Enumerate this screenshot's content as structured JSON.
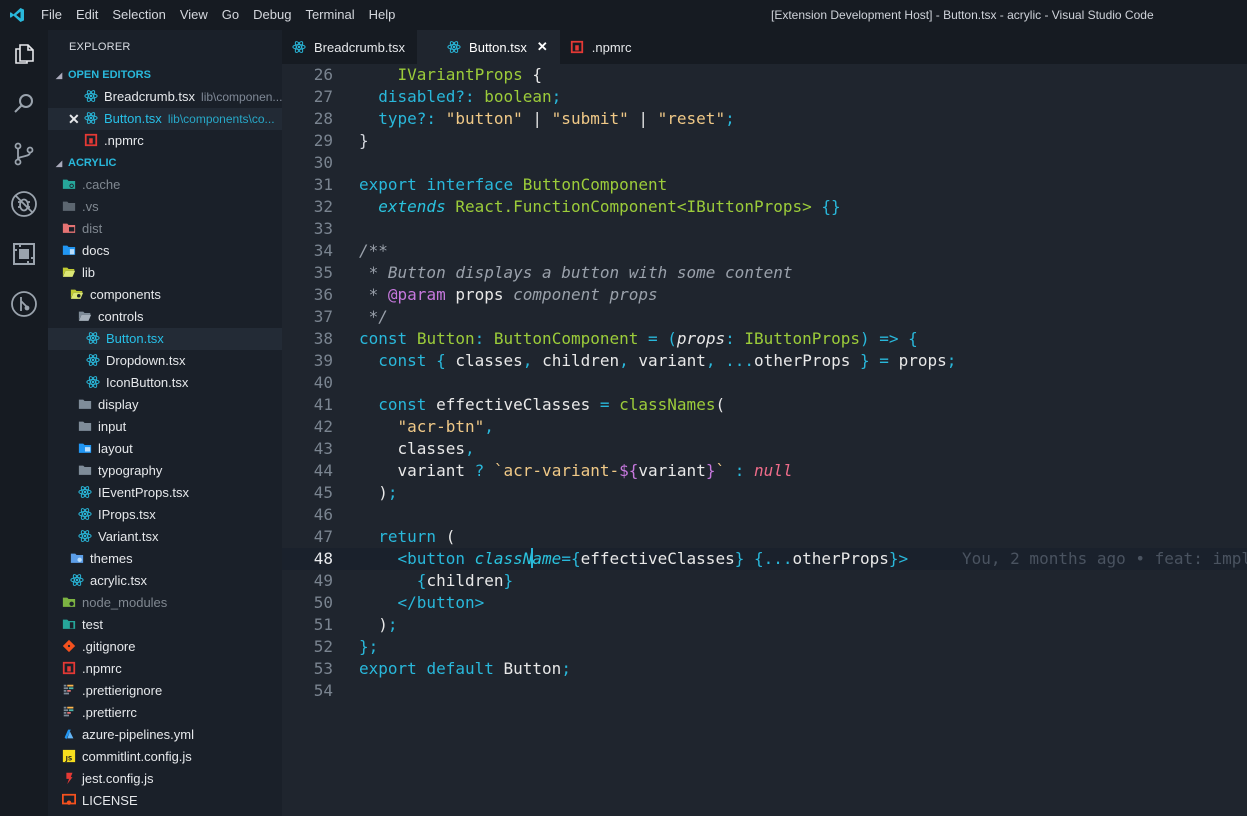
{
  "titlebar": {
    "menu": [
      "File",
      "Edit",
      "Selection",
      "View",
      "Go",
      "Debug",
      "Terminal",
      "Help"
    ],
    "window_title": "[Extension Development Host] - Button.tsx - acrylic - Visual Studio Code"
  },
  "activity_bar": [
    "explorer-icon",
    "search-icon",
    "source-control-icon",
    "debug-icon",
    "extensions-icon",
    "git-history-icon"
  ],
  "explorer": {
    "title": "EXPLORER",
    "open_editors_title": "OPEN EDITORS",
    "open_editors": [
      {
        "name": "Breadcrumb.tsx",
        "path": "lib\\componen..."
      },
      {
        "name": "Button.tsx",
        "path": "lib\\components\\co..."
      },
      {
        "name": ".npmrc",
        "path": ""
      }
    ],
    "project_title": "ACRYLIC",
    "tree": [
      {
        "label": ".cache"
      },
      {
        "label": ".vs"
      },
      {
        "label": "dist"
      },
      {
        "label": "docs"
      },
      {
        "label": "lib"
      },
      {
        "label": "components"
      },
      {
        "label": "controls"
      },
      {
        "label": "Button.tsx"
      },
      {
        "label": "Dropdown.tsx"
      },
      {
        "label": "IconButton.tsx"
      },
      {
        "label": "display"
      },
      {
        "label": "input"
      },
      {
        "label": "layout"
      },
      {
        "label": "typography"
      },
      {
        "label": "IEventProps.tsx"
      },
      {
        "label": "IProps.tsx"
      },
      {
        "label": "Variant.tsx"
      },
      {
        "label": "themes"
      },
      {
        "label": "acrylic.tsx"
      },
      {
        "label": "node_modules"
      },
      {
        "label": "test"
      },
      {
        "label": ".gitignore"
      },
      {
        "label": ".npmrc"
      },
      {
        "label": ".prettierignore"
      },
      {
        "label": ".prettierrc"
      },
      {
        "label": "azure-pipelines.yml"
      },
      {
        "label": "commitlint.config.js"
      },
      {
        "label": "jest.config.js"
      },
      {
        "label": "LICENSE"
      }
    ]
  },
  "tabs": [
    {
      "label": "Breadcrumb.tsx",
      "active": false
    },
    {
      "label": "Button.tsx",
      "active": true,
      "close": "✕"
    },
    {
      "label": ".npmrc",
      "active": false
    }
  ],
  "editor": {
    "current_line": 48,
    "blame": "You, 2 months ago • feat: impl",
    "lines": [
      {
        "n": "26",
        "tokens": [
          [
            "",
            "    "
          ],
          [
            "ty",
            "IVariantProps"
          ],
          [
            "p",
            " {"
          ]
        ]
      },
      {
        "n": "27",
        "tokens": [
          [
            "",
            "  "
          ],
          [
            "k",
            "disabled?:"
          ],
          [
            "",
            " "
          ],
          [
            "ty",
            "boolean"
          ],
          [
            "k",
            ";"
          ]
        ]
      },
      {
        "n": "28",
        "tokens": [
          [
            "",
            "  "
          ],
          [
            "k",
            "type?:"
          ],
          [
            "",
            " "
          ],
          [
            "s",
            "\"button\""
          ],
          [
            "p",
            " | "
          ],
          [
            "s",
            "\"submit\""
          ],
          [
            "p",
            " | "
          ],
          [
            "s",
            "\"reset\""
          ],
          [
            "k",
            ";"
          ]
        ]
      },
      {
        "n": "29",
        "tokens": [
          [
            "",
            "}"
          ]
        ]
      },
      {
        "n": "30",
        "tokens": []
      },
      {
        "n": "31",
        "tokens": [
          [
            "k",
            "export"
          ],
          [
            "",
            " "
          ],
          [
            "k",
            "interface"
          ],
          [
            "",
            " "
          ],
          [
            "ty",
            "ButtonComponent"
          ]
        ]
      },
      {
        "n": "32",
        "tokens": [
          [
            "",
            "  "
          ],
          [
            "i",
            "extends"
          ],
          [
            "",
            " "
          ],
          [
            "ty",
            "React.FunctionComponent<IButtonProps>"
          ],
          [
            "",
            " "
          ],
          [
            "k",
            "{}"
          ]
        ]
      },
      {
        "n": "33",
        "tokens": []
      },
      {
        "n": "34",
        "tokens": [
          [
            "c",
            "/**"
          ]
        ]
      },
      {
        "n": "35",
        "tokens": [
          [
            "c",
            " * Button displays a button with some content"
          ]
        ]
      },
      {
        "n": "36",
        "tokens": [
          [
            "c",
            " * "
          ],
          [
            "tm",
            "@param"
          ],
          [
            "",
            " "
          ],
          [
            "v",
            "props"
          ],
          [
            "c",
            " component props"
          ]
        ]
      },
      {
        "n": "37",
        "tokens": [
          [
            "c",
            " */"
          ]
        ]
      },
      {
        "n": "38",
        "tokens": [
          [
            "k",
            "const"
          ],
          [
            "",
            " "
          ],
          [
            "ty",
            "Button"
          ],
          [
            "k",
            ":"
          ],
          [
            "",
            " "
          ],
          [
            "ty",
            "ButtonComponent"
          ],
          [
            "k",
            " = ("
          ],
          [
            "pi",
            "props"
          ],
          [
            "k",
            ":"
          ],
          [
            "",
            " "
          ],
          [
            "ty",
            "IButtonProps"
          ],
          [
            "k",
            ") => {"
          ]
        ]
      },
      {
        "n": "39",
        "tokens": [
          [
            "",
            "  "
          ],
          [
            "k",
            "const"
          ],
          [
            "",
            " "
          ],
          [
            "k",
            "{"
          ],
          [
            "",
            " "
          ],
          [
            "v",
            "classes"
          ],
          [
            "k",
            ","
          ],
          [
            "",
            " "
          ],
          [
            "v",
            "children"
          ],
          [
            "k",
            ","
          ],
          [
            "",
            " "
          ],
          [
            "v",
            "variant"
          ],
          [
            "k",
            ","
          ],
          [
            "",
            " "
          ],
          [
            "k",
            "..."
          ],
          [
            "v",
            "otherProps"
          ],
          [
            "",
            " "
          ],
          [
            "k",
            "} ="
          ],
          [
            "",
            " "
          ],
          [
            "v",
            "props"
          ],
          [
            "k",
            ";"
          ]
        ]
      },
      {
        "n": "40",
        "tokens": []
      },
      {
        "n": "41",
        "tokens": [
          [
            "",
            "  "
          ],
          [
            "k",
            "const"
          ],
          [
            "",
            " "
          ],
          [
            "v",
            "effectiveClasses"
          ],
          [
            "",
            " "
          ],
          [
            "k",
            "="
          ],
          [
            "",
            " "
          ],
          [
            "ty",
            "classNames"
          ],
          [
            "p",
            "("
          ]
        ]
      },
      {
        "n": "42",
        "tokens": [
          [
            "",
            "    "
          ],
          [
            "s",
            "\"acr-btn\""
          ],
          [
            "k",
            ","
          ]
        ]
      },
      {
        "n": "43",
        "tokens": [
          [
            "",
            "    "
          ],
          [
            "v",
            "classes"
          ],
          [
            "k",
            ","
          ]
        ]
      },
      {
        "n": "44",
        "tokens": [
          [
            "",
            "    "
          ],
          [
            "v",
            "variant"
          ],
          [
            "",
            " "
          ],
          [
            "k",
            "?"
          ],
          [
            "",
            " "
          ],
          [
            "s",
            "`acr-variant-"
          ],
          [
            "tm",
            "${"
          ],
          [
            "v",
            "variant"
          ],
          [
            "tm",
            "}"
          ],
          [
            "s",
            "`"
          ],
          [
            "",
            " "
          ],
          [
            "k",
            ":"
          ],
          [
            "",
            " "
          ],
          [
            "n",
            "null"
          ]
        ]
      },
      {
        "n": "45",
        "tokens": [
          [
            "",
            "  "
          ],
          [
            "p",
            ")"
          ],
          [
            "k",
            ";"
          ]
        ]
      },
      {
        "n": "46",
        "tokens": []
      },
      {
        "n": "47",
        "tokens": [
          [
            "",
            "  "
          ],
          [
            "k",
            "return"
          ],
          [
            "",
            " "
          ],
          [
            "p",
            "("
          ]
        ]
      },
      {
        "n": "48",
        "tokens": [
          [
            "",
            "    "
          ],
          [
            "t",
            "<button"
          ],
          [
            "",
            " "
          ],
          [
            "i",
            "classN"
          ],
          [
            "caret",
            ""
          ],
          [
            "i",
            "ame"
          ],
          [
            "k",
            "={"
          ],
          [
            "v",
            "effectiveClasses"
          ],
          [
            "k",
            "}"
          ],
          [
            "",
            " "
          ],
          [
            "k",
            "{..."
          ],
          [
            "v",
            "otherProps"
          ],
          [
            "k",
            "}"
          ],
          [
            "t",
            ">"
          ]
        ]
      },
      {
        "n": "49",
        "tokens": [
          [
            "",
            "      "
          ],
          [
            "k",
            "{"
          ],
          [
            "v",
            "children"
          ],
          [
            "k",
            "}"
          ]
        ]
      },
      {
        "n": "50",
        "tokens": [
          [
            "",
            "    "
          ],
          [
            "t",
            "</button>"
          ]
        ]
      },
      {
        "n": "51",
        "tokens": [
          [
            "",
            "  "
          ],
          [
            "p",
            ")"
          ],
          [
            "k",
            ";"
          ]
        ]
      },
      {
        "n": "52",
        "tokens": [
          [
            "k",
            "};"
          ]
        ]
      },
      {
        "n": "53",
        "tokens": [
          [
            "k",
            "export"
          ],
          [
            "",
            " "
          ],
          [
            "k",
            "default"
          ],
          [
            "",
            " "
          ],
          [
            "v",
            "Button"
          ],
          [
            "k",
            ";"
          ]
        ]
      },
      {
        "n": "54",
        "tokens": []
      }
    ]
  }
}
